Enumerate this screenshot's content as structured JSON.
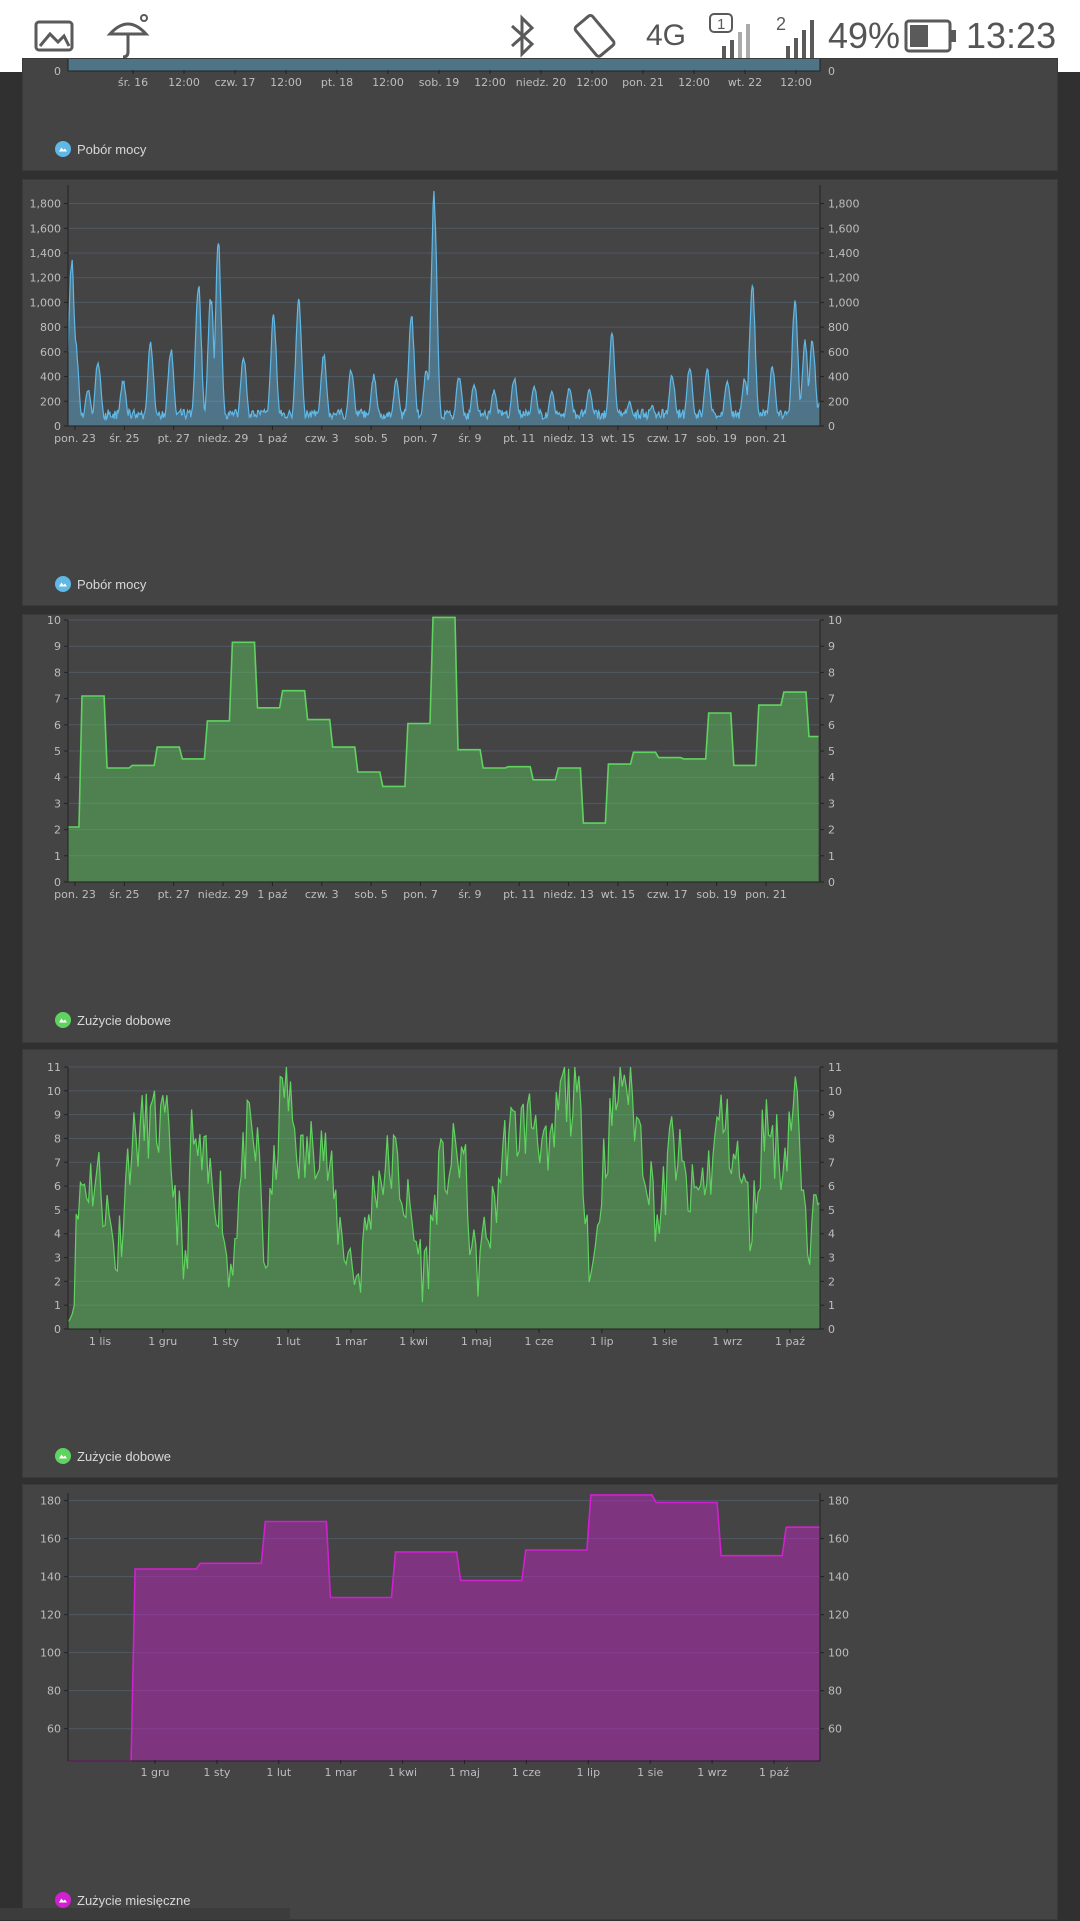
{
  "status_bar": {
    "battery": "49%",
    "time": "13:23",
    "network": "4G",
    "sim1": "1",
    "sim2": "2",
    "icons": [
      "gallery-icon",
      "umbrella-icon",
      "bluetooth-icon",
      "auto-rotate-icon",
      "data-4g-icon",
      "signal-sim1-icon",
      "signal-sim2-icon",
      "battery-icon"
    ]
  },
  "colors": {
    "power": "#5fb8e6",
    "daily": "#5fd35f",
    "monthly": "#d020d0"
  },
  "chart_data": [
    {
      "type": "area",
      "legend": "Pobór mocy",
      "x_labels": [
        "śr. 16",
        "12:00",
        "czw. 17",
        "12:00",
        "pt. 18",
        "12:00",
        "sob. 19",
        "12:00",
        "niedz. 20",
        "12:00",
        "pon. 21",
        "12:00",
        "wt. 22",
        "12:00"
      ],
      "y_ticks": [
        "0"
      ],
      "note": "partially visible"
    },
    {
      "type": "area",
      "legend": "Pobór mocy",
      "ylim": [
        0,
        1950
      ],
      "y_ticks": [
        "0",
        "200",
        "400",
        "600",
        "800",
        "1,000",
        "1,200",
        "1,400",
        "1,600",
        "1,800"
      ],
      "x_labels": [
        "pon. 23",
        "śr. 25",
        "pt. 27",
        "niedz. 29",
        "1 paź",
        "czw. 3",
        "sob. 5",
        "pon. 7",
        "śr. 9",
        "pt. 11",
        "niedz. 13",
        "wt. 15",
        "czw. 17",
        "sob. 19",
        "pon. 21"
      ],
      "x_range": [
        0,
        30
      ],
      "peaks": [
        [
          0.15,
          1400
        ],
        [
          0.3,
          700
        ],
        [
          0.8,
          300
        ],
        [
          1.2,
          550
        ],
        [
          2.2,
          380
        ],
        [
          3.3,
          700
        ],
        [
          4.1,
          650
        ],
        [
          5.2,
          1200
        ],
        [
          5.7,
          1100
        ],
        [
          6.0,
          1520
        ],
        [
          7.0,
          600
        ],
        [
          8.2,
          920
        ],
        [
          9.2,
          1070
        ],
        [
          10.2,
          600
        ],
        [
          11.3,
          480
        ],
        [
          12.2,
          430
        ],
        [
          13.1,
          380
        ],
        [
          13.7,
          940
        ],
        [
          14.3,
          480
        ],
        [
          14.6,
          1930
        ],
        [
          15.6,
          420
        ],
        [
          16.2,
          360
        ],
        [
          17.0,
          300
        ],
        [
          17.8,
          400
        ],
        [
          18.6,
          330
        ],
        [
          19.3,
          280
        ],
        [
          20.0,
          330
        ],
        [
          20.8,
          300
        ],
        [
          21.7,
          760
        ],
        [
          22.4,
          200
        ],
        [
          23.3,
          170
        ],
        [
          24.1,
          430
        ],
        [
          24.8,
          500
        ],
        [
          25.5,
          480
        ],
        [
          26.3,
          380
        ],
        [
          27.0,
          400
        ],
        [
          27.3,
          1180
        ],
        [
          28.1,
          500
        ],
        [
          29.0,
          1030
        ],
        [
          29.4,
          700
        ],
        [
          29.7,
          720
        ],
        [
          30,
          200
        ]
      ],
      "baseline": 90
    },
    {
      "type": "area-step",
      "legend": "Zużycie dobowe",
      "ylim": [
        0,
        10
      ],
      "y_ticks": [
        "0",
        "1",
        "2",
        "3",
        "4",
        "5",
        "6",
        "7",
        "8",
        "9",
        "10"
      ],
      "x_labels": [
        "pon. 23",
        "śr. 25",
        "pt. 27",
        "niedz. 29",
        "1 paź",
        "czw. 3",
        "sob. 5",
        "pon. 7",
        "śr. 9",
        "pt. 11",
        "niedz. 13",
        "wt. 15",
        "czw. 17",
        "sob. 19",
        "pon. 21"
      ],
      "x_range": [
        0,
        30
      ],
      "values": [
        2.1,
        7.1,
        4.35,
        4.45,
        5.15,
        4.7,
        6.15,
        9.15,
        6.65,
        7.3,
        6.2,
        5.15,
        4.2,
        3.65,
        6.05,
        10.1,
        5.05,
        4.35,
        4.4,
        3.9,
        4.35,
        2.25,
        4.5,
        4.95,
        4.75,
        4.7,
        6.45,
        4.45,
        6.75,
        7.25,
        5.55
      ]
    },
    {
      "type": "area",
      "legend": "Zużycie dobowe",
      "ylim": [
        0,
        11
      ],
      "y_ticks": [
        "0",
        "1",
        "2",
        "3",
        "4",
        "5",
        "6",
        "7",
        "8",
        "9",
        "10",
        "11"
      ],
      "x_labels": [
        "1 lis",
        "1 gru",
        "1 sty",
        "1 lut",
        "1 mar",
        "1 kwi",
        "1 maj",
        "1 cze",
        "1 lip",
        "1 sie",
        "1 wrz",
        "1 paź"
      ],
      "x_range": [
        0,
        12.2
      ],
      "peaks": [
        [
          0.05,
          0.6
        ],
        [
          0.2,
          6.1
        ],
        [
          0.5,
          6.4
        ],
        [
          0.8,
          3.0
        ],
        [
          1.0,
          7.6
        ],
        [
          1.3,
          8.7
        ],
        [
          1.6,
          8.3
        ],
        [
          1.8,
          4.5
        ],
        [
          1.9,
          1.8
        ],
        [
          2.0,
          7.8
        ],
        [
          2.3,
          6.2
        ],
        [
          2.5,
          5.5
        ],
        [
          2.6,
          2.0
        ],
        [
          2.9,
          8.1
        ],
        [
          3.1,
          7.2
        ],
        [
          3.2,
          2.2
        ],
        [
          3.4,
          8.1
        ],
        [
          3.5,
          10.5
        ],
        [
          3.8,
          6.9
        ],
        [
          4.1,
          8.3
        ],
        [
          4.4,
          4.3
        ],
        [
          4.7,
          2.1
        ],
        [
          5.0,
          6.3
        ],
        [
          5.3,
          7.1
        ],
        [
          5.6,
          4.1
        ],
        [
          5.8,
          2.2
        ],
        [
          6.0,
          6.3
        ],
        [
          6.4,
          7.5
        ],
        [
          6.6,
          2.3
        ],
        [
          6.9,
          4.8
        ],
        [
          7.1,
          7.9
        ],
        [
          7.4,
          8.6
        ],
        [
          7.6,
          9.0
        ],
        [
          7.8,
          6.4
        ],
        [
          8.0,
          10.1
        ],
        [
          8.3,
          9.2
        ],
        [
          8.5,
          2.0
        ],
        [
          8.7,
          7.3
        ],
        [
          9.0,
          11.0
        ],
        [
          9.3,
          8.0
        ],
        [
          9.6,
          4.3
        ],
        [
          9.8,
          8.0
        ],
        [
          10.1,
          5.3
        ],
        [
          10.4,
          6.6
        ],
        [
          10.6,
          9.0
        ],
        [
          10.9,
          6.6
        ],
        [
          11.1,
          4.2
        ],
        [
          11.3,
          8.9
        ],
        [
          11.6,
          7.0
        ],
        [
          11.8,
          10.1
        ],
        [
          12.0,
          2.3
        ],
        [
          12.1,
          7.2
        ],
        [
          12.2,
          6.6
        ]
      ],
      "baseline": 3.6
    },
    {
      "type": "area-step",
      "legend": "Zużycie miesięczne",
      "ylim": [
        43,
        184
      ],
      "y_ticks": [
        "60",
        "80",
        "100",
        "120",
        "140",
        "160",
        "180"
      ],
      "x_labels": [
        "1 gru",
        "1 sty",
        "1 lut",
        "1 mar",
        "1 kwi",
        "1 maj",
        "1 cze",
        "1 lip",
        "1 sie",
        "1 wrz",
        "1 paź"
      ],
      "x_range": [
        -1,
        10.55
      ],
      "values": [
        43,
        144,
        147,
        169,
        129,
        153,
        138,
        154,
        183,
        179,
        151,
        166
      ]
    }
  ]
}
